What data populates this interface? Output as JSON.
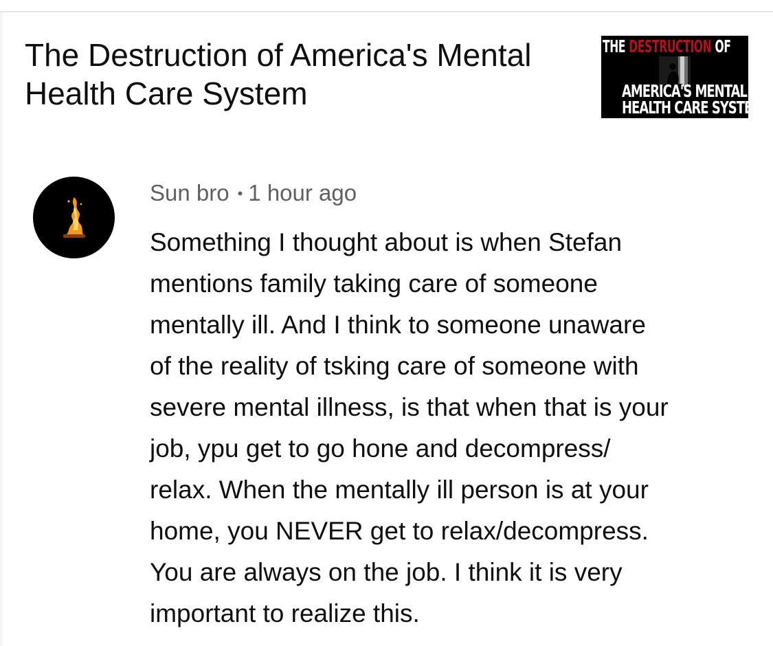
{
  "video": {
    "title": "The Destruction of America's Mental Health Care System",
    "thumbnail": {
      "line1_white": "THE ",
      "line1_red": "DESTRUCTION",
      "line1_white_end": " OF",
      "line2": "AMERICA'S MENTAL",
      "line3": "HEALTH CARE SYSTEM"
    }
  },
  "comment": {
    "author": "Sun bro",
    "separator": "•",
    "timestamp": "1 hour ago",
    "avatar_icon": "campfire-icon",
    "body_lines": [
      "Something I thought about is when Stefan",
      "mentions family taking care of someone",
      "mentally ill. And I think to someone unaware",
      "of the reality of tsking care of someone with",
      "severe mental illness, is that when that is your",
      "job, ypu get to go hone and decompress/",
      "relax. When the mentally ill person is at your",
      "home, you NEVER get to relax/decompress.",
      "You are always on the job. I think it is very",
      "important to realize this."
    ]
  },
  "colors": {
    "text_primary": "#0f0f0f",
    "text_secondary": "#606060",
    "thumbnail_accent": "#b3121d",
    "avatar_flame": "#f39a1e"
  }
}
